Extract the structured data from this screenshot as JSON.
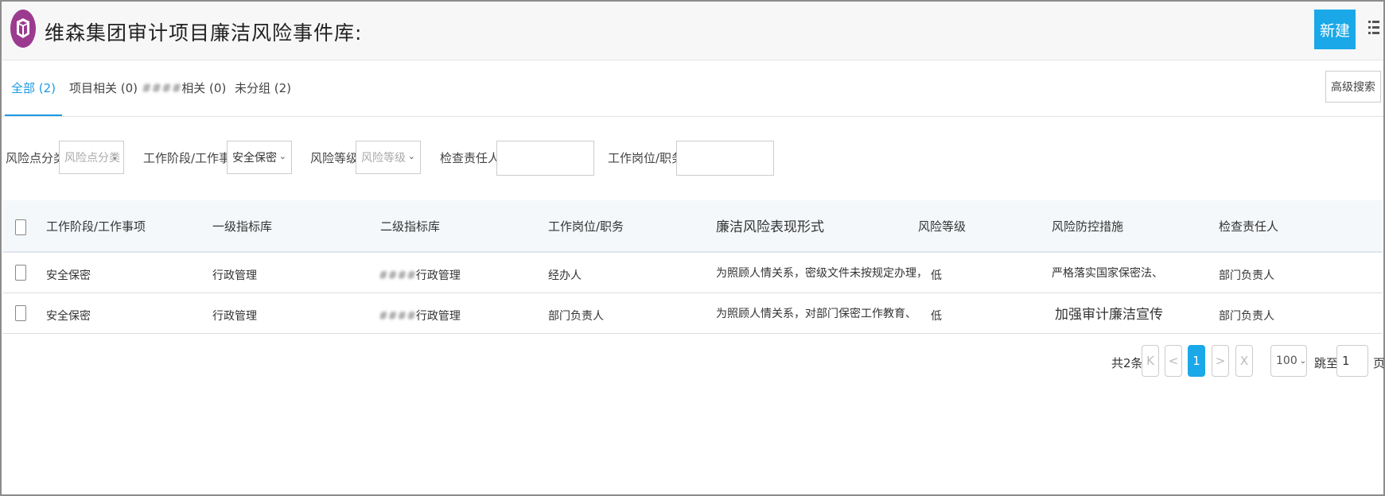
{
  "header": {
    "title": "维森集团审计项目廉洁风险事件库:",
    "new_button": "新建",
    "brand_color": "#9b3a8f",
    "accent_color": "#1aa8e8"
  },
  "tabs": [
    {
      "label": "全部 (2)",
      "active": true
    },
    {
      "label": "项目相关 (0)",
      "active": false
    },
    {
      "label": "相关 (0)",
      "active": false,
      "prefix_obscured": "####"
    },
    {
      "label": "未分组 (2)",
      "active": false
    }
  ],
  "advanced_search": "高级搜索",
  "filters": {
    "risk_category": {
      "label": "风险点分类",
      "placeholder": "风险点分类"
    },
    "work_stage": {
      "label": "工作阶段/工作事项",
      "value": "安全保密"
    },
    "risk_level": {
      "label": "风险等级",
      "placeholder": "风险等级"
    },
    "inspector": {
      "label": "检查责任人",
      "value": ""
    },
    "position": {
      "label": "工作岗位/职务",
      "value": ""
    }
  },
  "table": {
    "columns": [
      "工作阶段/工作事项",
      "一级指标库",
      "二级指标库",
      "工作岗位/职务",
      "廉洁风险表现形式",
      "风险等级",
      "风险防控措施",
      "检查责任人"
    ],
    "rows": [
      {
        "stage": "安全保密",
        "l1": "行政管理",
        "l2": "行政管理",
        "l2_prefix": "####",
        "position": "经办人",
        "form": "为照顾人情关系，密级文件未按规定办理，",
        "level": "低",
        "measure": "严格落实国家保密法、",
        "owner": "部门负责人"
      },
      {
        "stage": "安全保密",
        "l1": "行政管理",
        "l2": "行政管理",
        "l2_prefix": "####",
        "position": "部门负责人",
        "form": "为照顾人情关系，对部门保密工作教育、",
        "level": "低",
        "measure": "加强审计廉洁宣传",
        "owner": "部门负责人"
      }
    ]
  },
  "pagination": {
    "total": "共2条",
    "first": "K",
    "prev": "<",
    "current": "1",
    "next": ">",
    "last": "X",
    "page_size": "100",
    "jump_label": "跳至",
    "jump_value": "1",
    "page_suffix": "页"
  }
}
